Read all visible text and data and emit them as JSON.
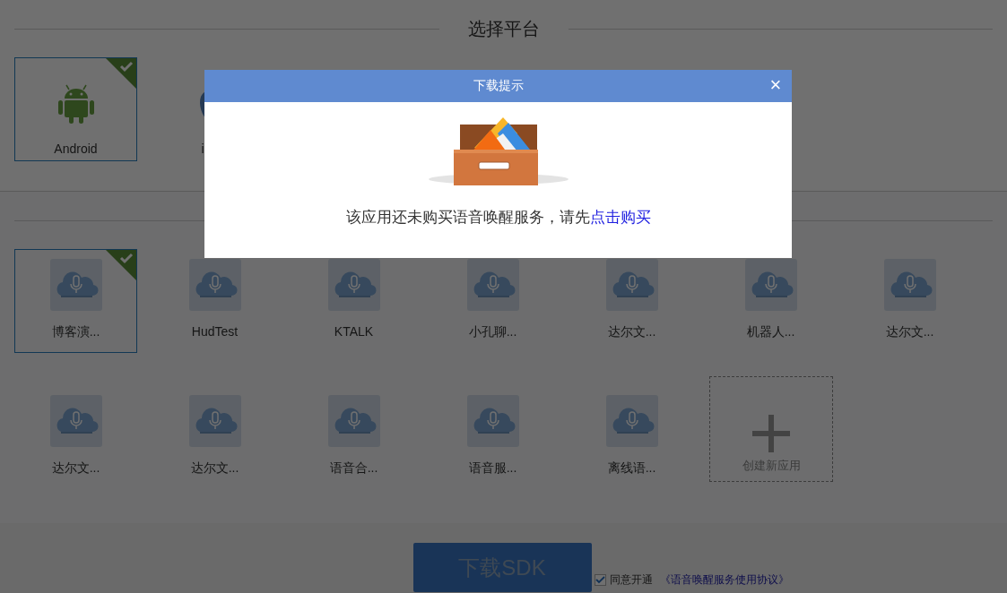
{
  "page_title": "选择平台",
  "platforms": [
    {
      "name": "Android",
      "kind": "android",
      "selected": true
    },
    {
      "name": "i",
      "kind": "apple",
      "selected": false
    }
  ],
  "apps": [
    {
      "name": "博客演...",
      "selected": true
    },
    {
      "name": "HudTest",
      "selected": false
    },
    {
      "name": "KTALK",
      "selected": false
    },
    {
      "name": "小孔聊...",
      "selected": false
    },
    {
      "name": "达尔文...",
      "selected": false
    },
    {
      "name": "机器人...",
      "selected": false
    },
    {
      "name": "达尔文...",
      "selected": false
    },
    {
      "name": "达尔文...",
      "selected": false
    },
    {
      "name": "达尔文...",
      "selected": false
    },
    {
      "name": "语音合...",
      "selected": false
    },
    {
      "name": "语音服...",
      "selected": false
    },
    {
      "name": "离线语...",
      "selected": false
    }
  ],
  "create_app": {
    "label": "创建新应用"
  },
  "download_button": "下载SDK",
  "agreement": {
    "checked": true,
    "text": "同意开通",
    "link": "《语音唤醒服务使用协议》"
  },
  "dialog": {
    "title": "下载提示",
    "close": "×",
    "message": "该应用还未购买语音唤醒服务，请先",
    "link": "点击购买"
  }
}
